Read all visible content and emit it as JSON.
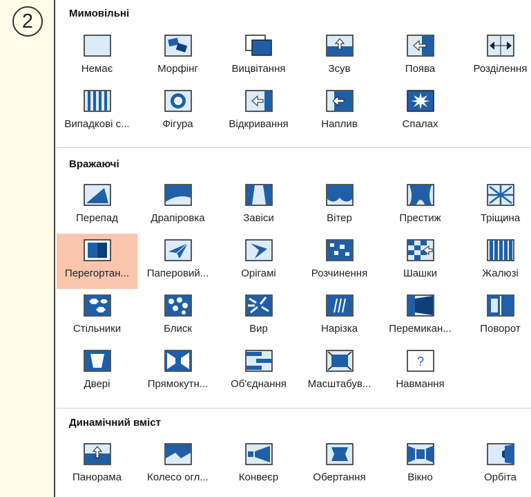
{
  "step_number": "2",
  "sections": [
    {
      "title": "Мимовільні",
      "items": [
        {
          "label": "Немає",
          "icon": "none-icon"
        },
        {
          "label": "Морфінг",
          "icon": "morph-icon"
        },
        {
          "label": "Вицвітання",
          "icon": "fade-icon"
        },
        {
          "label": "Зсув",
          "icon": "push-icon"
        },
        {
          "label": "Поява",
          "icon": "wipe-icon"
        },
        {
          "label": "Розділення",
          "icon": "split-icon"
        },
        {
          "label": "Випадкові с...",
          "icon": "random-bars-icon"
        },
        {
          "label": "Фігура",
          "icon": "shape-icon"
        },
        {
          "label": "Відкривання",
          "icon": "uncover-icon"
        },
        {
          "label": "Наплив",
          "icon": "cover-icon"
        },
        {
          "label": "Спалах",
          "icon": "flash-icon"
        }
      ]
    },
    {
      "title": "Вражаючі",
      "items": [
        {
          "label": "Перепад",
          "icon": "fall-over-icon"
        },
        {
          "label": "Драпіровка",
          "icon": "drape-icon"
        },
        {
          "label": "Завіси",
          "icon": "curtains-icon"
        },
        {
          "label": "Вітер",
          "icon": "wind-icon"
        },
        {
          "label": "Престиж",
          "icon": "prestige-icon"
        },
        {
          "label": "Тріщина",
          "icon": "fracture-icon"
        },
        {
          "label": "Перегортан...",
          "icon": "page-curl-icon",
          "selected": true
        },
        {
          "label": "Паперовий...",
          "icon": "airplane-icon"
        },
        {
          "label": "Орігамі",
          "icon": "origami-icon"
        },
        {
          "label": "Розчинення",
          "icon": "dissolve-icon"
        },
        {
          "label": "Шашки",
          "icon": "checkerboard-icon"
        },
        {
          "label": "Жалюзі",
          "icon": "blinds-icon"
        },
        {
          "label": "Стільники",
          "icon": "honeycomb-icon"
        },
        {
          "label": "Блиск",
          "icon": "glitter-icon"
        },
        {
          "label": "Вир",
          "icon": "vortex-icon"
        },
        {
          "label": "Нарізка",
          "icon": "shred-icon"
        },
        {
          "label": "Перемикан...",
          "icon": "switch-icon"
        },
        {
          "label": "Поворот",
          "icon": "flip-icon"
        },
        {
          "label": "Двері",
          "icon": "doors-icon"
        },
        {
          "label": "Прямокутн...",
          "icon": "box-icon"
        },
        {
          "label": "Об'єднання",
          "icon": "comb-icon"
        },
        {
          "label": "Масштабув...",
          "icon": "zoom-icon"
        },
        {
          "label": "Навмання",
          "icon": "random-icon"
        }
      ]
    },
    {
      "title": "Динамічний вміст",
      "items": [
        {
          "label": "Панорама",
          "icon": "pan-icon"
        },
        {
          "label": "Колесо огл...",
          "icon": "ferris-wheel-icon"
        },
        {
          "label": "Конвеєр",
          "icon": "conveyor-icon"
        },
        {
          "label": "Обертання",
          "icon": "rotate-icon"
        },
        {
          "label": "Вікно",
          "icon": "window-icon"
        },
        {
          "label": "Орбіта",
          "icon": "orbit-icon"
        }
      ]
    }
  ]
}
